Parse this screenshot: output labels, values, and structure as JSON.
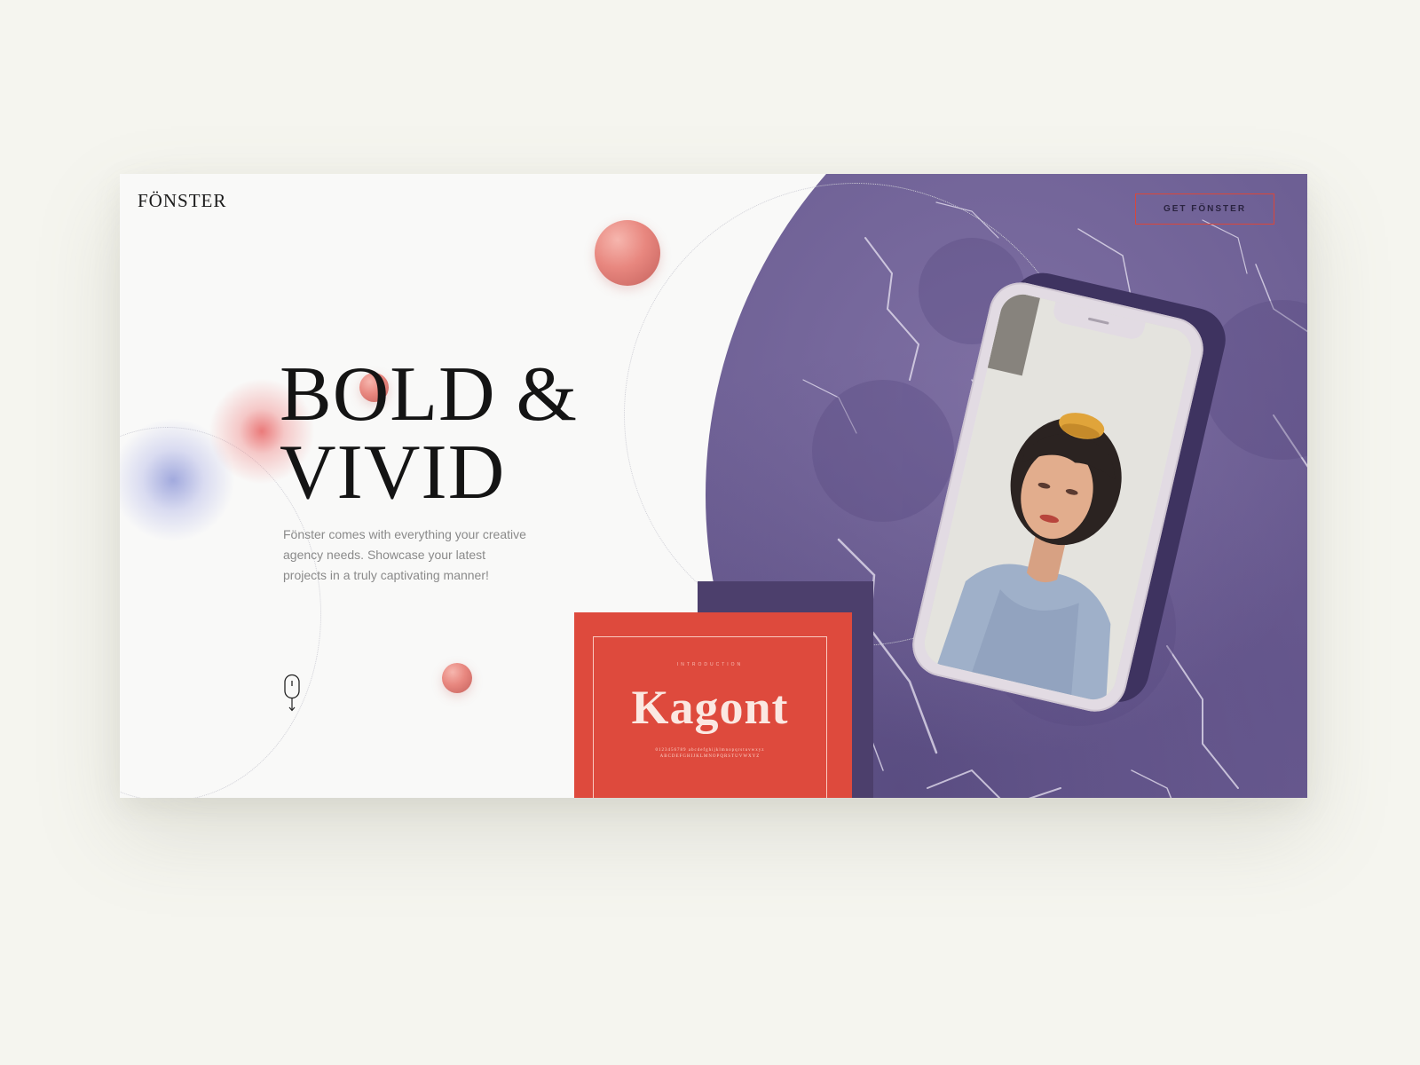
{
  "brand": {
    "logo": "FÖNSTER"
  },
  "header": {
    "cta_label": "GET FÖNSTER"
  },
  "hero": {
    "headline_line1": "BOLD &",
    "headline_line2": "VIVID",
    "description": "Fönster comes with everything your creative agency needs. Showcase your latest projects in a truly captivating manner!"
  },
  "showcase": {
    "book_eyebrow": "INTRODUCTION",
    "book_title": "Kagont",
    "book_charset_lower": "0123456789 abcdefghijklmnopqrstuvwxyz",
    "book_charset_upper": "ABCDEFGHIJKLMNOPQRSTUVWXYZ"
  },
  "icons": {
    "scroll": "mouse-scroll-icon"
  },
  "colors": {
    "background": "#f5f5ef",
    "accent_red": "#de4a3d",
    "marble_purple": "#6d5f94",
    "deep_purple": "#4c3f6c",
    "orb_pink": "#e8877f",
    "text_dark": "#141414",
    "text_muted": "#8a8a8a"
  }
}
